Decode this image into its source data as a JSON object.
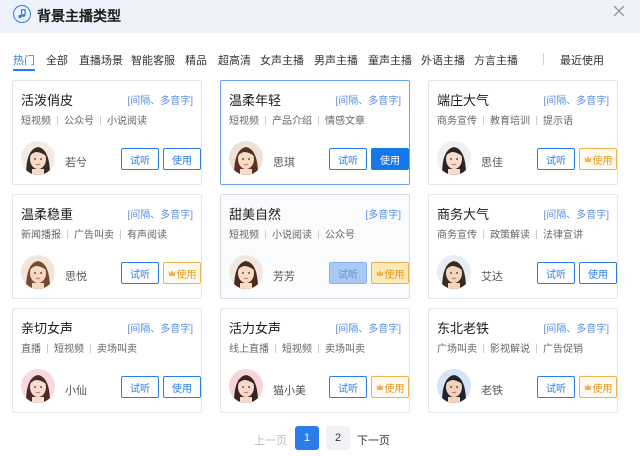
{
  "header": {
    "title": "背景主播类型"
  },
  "tabs": [
    {
      "label": "热门",
      "active": true
    },
    {
      "label": "全部"
    },
    {
      "label": "直播场景"
    },
    {
      "label": "智能客服"
    },
    {
      "label": "精品"
    },
    {
      "label": "超高清"
    },
    {
      "label": "女声主播"
    },
    {
      "label": "男声主播"
    },
    {
      "label": "童声主播"
    },
    {
      "label": "外语主播"
    },
    {
      "label": "方言主播"
    },
    {
      "label": "最近使用"
    }
  ],
  "cards": [
    {
      "name": "活泼俏皮",
      "note": "[间隔、多音字]",
      "cats": [
        "短视频",
        "公众号",
        "小说阅读"
      ],
      "person": "若兮",
      "listen": "试听",
      "use": "使用",
      "use_style": "normal"
    },
    {
      "name": "温柔年轻",
      "note": "[间隔、多音字]",
      "cats": [
        "短视频",
        "产品介绍",
        "情感文章"
      ],
      "person": "思琪",
      "listen": "试听",
      "use": "使用",
      "use_style": "primary"
    },
    {
      "name": "端庄大气",
      "note": "[间隔、多音字]",
      "cats": [
        "商务宣传",
        "教育培训",
        "提示语"
      ],
      "person": "思佳",
      "listen": "试听",
      "use": "使用",
      "use_style": "vip"
    },
    {
      "name": "温柔稳重",
      "note": "[间隔、多音字]",
      "cats": [
        "新闻播报",
        "广告叫卖",
        "有声阅读"
      ],
      "person": "思悦",
      "listen": "试听",
      "use": "使用",
      "use_style": "vip"
    },
    {
      "name": "甜美自然",
      "note": "[多音字]",
      "cats": [
        "短视频",
        "小说阅读",
        "公众号"
      ],
      "person": "芳芳",
      "listen": "试听",
      "use": "使用",
      "use_style": "vip"
    },
    {
      "name": "商务大气",
      "note": "[间隔、多音字]",
      "cats": [
        "商务宣传",
        "政策解读",
        "法律宣讲"
      ],
      "person": "艾达",
      "listen": "试听",
      "use": "使用",
      "use_style": "normal"
    },
    {
      "name": "亲切女声",
      "note": "[间隔、多音字]",
      "cats": [
        "直播",
        "短视频",
        "卖场叫卖"
      ],
      "person": "小仙",
      "listen": "试听",
      "use": "使用",
      "use_style": "normal"
    },
    {
      "name": "活力女声",
      "note": "[间隔、多音字]",
      "cats": [
        "线上直播",
        "短视频",
        "卖场叫卖"
      ],
      "person": "猫小美",
      "listen": "试听",
      "use": "使用",
      "use_style": "vip"
    },
    {
      "name": "东北老铁",
      "note": "[间隔、多音字]",
      "cats": [
        "广场叫卖",
        "影视解说",
        "广告促销"
      ],
      "person": "老铁",
      "listen": "试听",
      "use": "使用",
      "use_style": "vip"
    }
  ],
  "pager": {
    "prev": "上一页",
    "pages": [
      "1",
      "2"
    ],
    "current": "1",
    "next": "下一页"
  }
}
